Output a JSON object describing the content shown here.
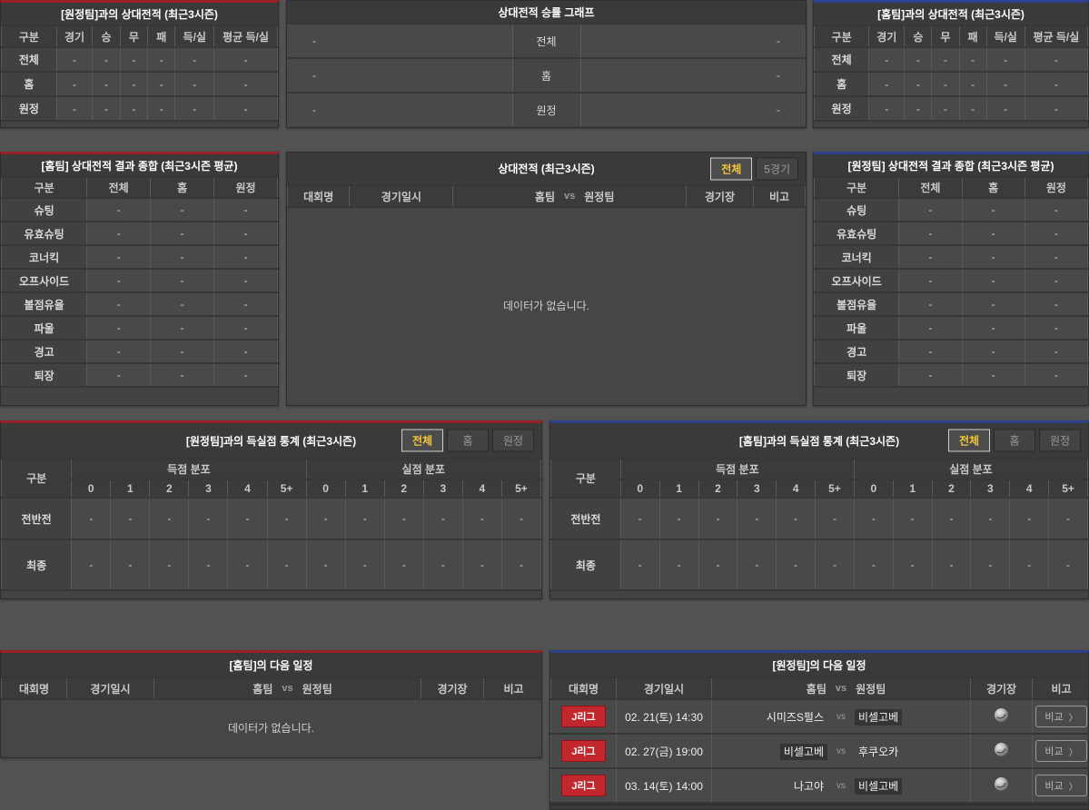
{
  "dash": "-",
  "empty_text": "데이터가 없습니다.",
  "panels": {
    "h2h_vs_away": {
      "title": "[원정팀]과의 상대전적 (최근3시즌)",
      "columns": [
        "구분",
        "경기",
        "승",
        "무",
        "패",
        "득/실",
        "평균 득/실"
      ],
      "rows": [
        {
          "label": "전체"
        },
        {
          "label": "홈"
        },
        {
          "label": "원정"
        }
      ]
    },
    "winrate_graph": {
      "title": "상대전적 승률 그래프",
      "rows": [
        {
          "label": "전체"
        },
        {
          "label": "홈"
        },
        {
          "label": "원정"
        }
      ]
    },
    "h2h_vs_home": {
      "title": "[홈팀]과의 상대전적 (최근3시즌)",
      "columns": [
        "구분",
        "경기",
        "승",
        "무",
        "패",
        "득/실",
        "평균 득/실"
      ],
      "rows": [
        {
          "label": "전체"
        },
        {
          "label": "홈"
        },
        {
          "label": "원정"
        }
      ]
    },
    "summary_home": {
      "title": "[홈팀] 상대전적 결과 종합 (최근3시즌 평균)",
      "columns": [
        "구분",
        "전체",
        "홈",
        "원정"
      ],
      "rows": [
        {
          "label": "슈팅"
        },
        {
          "label": "유효슈팅"
        },
        {
          "label": "코너킥"
        },
        {
          "label": "오프사이드"
        },
        {
          "label": "볼점유율"
        },
        {
          "label": "파울"
        },
        {
          "label": "경고"
        },
        {
          "label": "퇴장"
        }
      ]
    },
    "h2h_list": {
      "title": "상대전적 (최근3시즌)",
      "tabs": [
        "전체",
        "5경기"
      ],
      "headers": {
        "league": "대회명",
        "datetime": "경기일시",
        "home": "홈팀",
        "vs": "vs",
        "away": "원정팀",
        "stadium": "경기장",
        "note": "비고"
      }
    },
    "summary_away": {
      "title": "[원정팀] 상대전적 결과 종합 (최근3시즌 평균)",
      "columns": [
        "구분",
        "전체",
        "홈",
        "원정"
      ],
      "rows": [
        {
          "label": "슈팅"
        },
        {
          "label": "유효슈팅"
        },
        {
          "label": "코너킥"
        },
        {
          "label": "오프사이드"
        },
        {
          "label": "볼점유율"
        },
        {
          "label": "파울"
        },
        {
          "label": "경고"
        },
        {
          "label": "퇴장"
        }
      ]
    },
    "goals_vs_away": {
      "title": "[원정팀]과의 득실점 통계 (최근3시즌)",
      "tabs": [
        "전체",
        "홈",
        "원정"
      ],
      "corner": "구분",
      "groups": [
        "득점 분포",
        "실점 분포"
      ],
      "score_cols": [
        "0",
        "1",
        "2",
        "3",
        "4",
        "5+"
      ],
      "rows": [
        {
          "label": "전반전"
        },
        {
          "label": "최종"
        }
      ]
    },
    "goals_vs_home": {
      "title": "[홈팀]과의 득실점 통계 (최근3시즌)",
      "tabs": [
        "전체",
        "홈",
        "원정"
      ],
      "corner": "구분",
      "groups": [
        "득점 분포",
        "실점 분포"
      ],
      "score_cols": [
        "0",
        "1",
        "2",
        "3",
        "4",
        "5+"
      ],
      "rows": [
        {
          "label": "전반전"
        },
        {
          "label": "최종"
        }
      ]
    },
    "schedule_home": {
      "title": "[홈팀]의 다음 일정",
      "headers": {
        "league": "대회명",
        "datetime": "경기일시",
        "home": "홈팀",
        "vs": "vs",
        "away": "원정팀",
        "stadium": "경기장",
        "note": "비고"
      }
    },
    "schedule_away": {
      "title": "[원정팀]의 다음 일정",
      "headers": {
        "league": "대회명",
        "datetime": "경기일시",
        "home": "홈팀",
        "vs": "vs",
        "away": "원정팀",
        "stadium": "경기장",
        "note": "비고"
      },
      "compare_label": "비교",
      "chevron": "〉",
      "rows": [
        {
          "league": "J리그",
          "datetime": "02. 21(토) 14:30",
          "home": "시미즈S펄스",
          "vs": "vs",
          "away": "비셀고베"
        },
        {
          "league": "J리그",
          "datetime": "02. 27(금) 19:00",
          "home": "비셀고베",
          "vs": "vs",
          "away": "후쿠오카"
        },
        {
          "league": "J리그",
          "datetime": "03. 14(토) 14:00",
          "home": "나고야",
          "vs": "vs",
          "away": "비셀고베"
        }
      ]
    }
  }
}
